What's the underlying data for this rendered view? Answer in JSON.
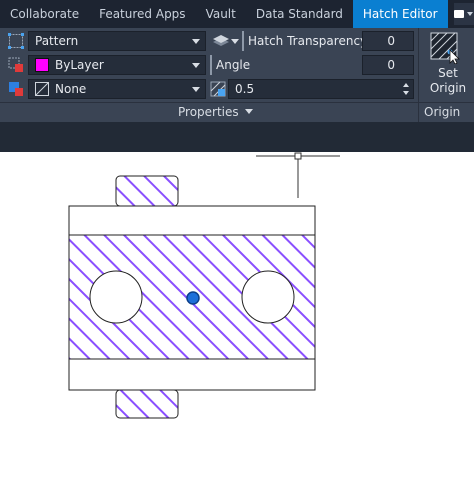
{
  "tabs": [
    {
      "label": "Collaborate",
      "active": false
    },
    {
      "label": "Featured Apps",
      "active": false
    },
    {
      "label": "Vault",
      "active": false
    },
    {
      "label": "Data Standard",
      "active": false
    },
    {
      "label": "Hatch Editor",
      "active": true
    }
  ],
  "ribbon": {
    "hatch_type": {
      "value": "Pattern",
      "icon": "hatch-pattern-icon"
    },
    "hatch_color": {
      "value": "ByLayer",
      "swatch": "#ff00ff",
      "icon": "hatch-color-icon"
    },
    "background_color": {
      "value": "None",
      "icon": "background-color-icon"
    },
    "transparency": {
      "label": "Hatch Transparency",
      "value": "0",
      "icon": "layers-icon"
    },
    "angle": {
      "label": "Angle",
      "value": "0"
    },
    "scale": {
      "value": "0.5",
      "icon": "hatch-scale-icon"
    },
    "set_origin": {
      "line1": "Set",
      "line2": "Origin"
    },
    "panels": {
      "properties": "Properties",
      "origin": "Origin"
    }
  },
  "colors": {
    "accent": "#0a7fd1",
    "hatch": "#8a4fff",
    "grip": "#1e6fd9"
  }
}
